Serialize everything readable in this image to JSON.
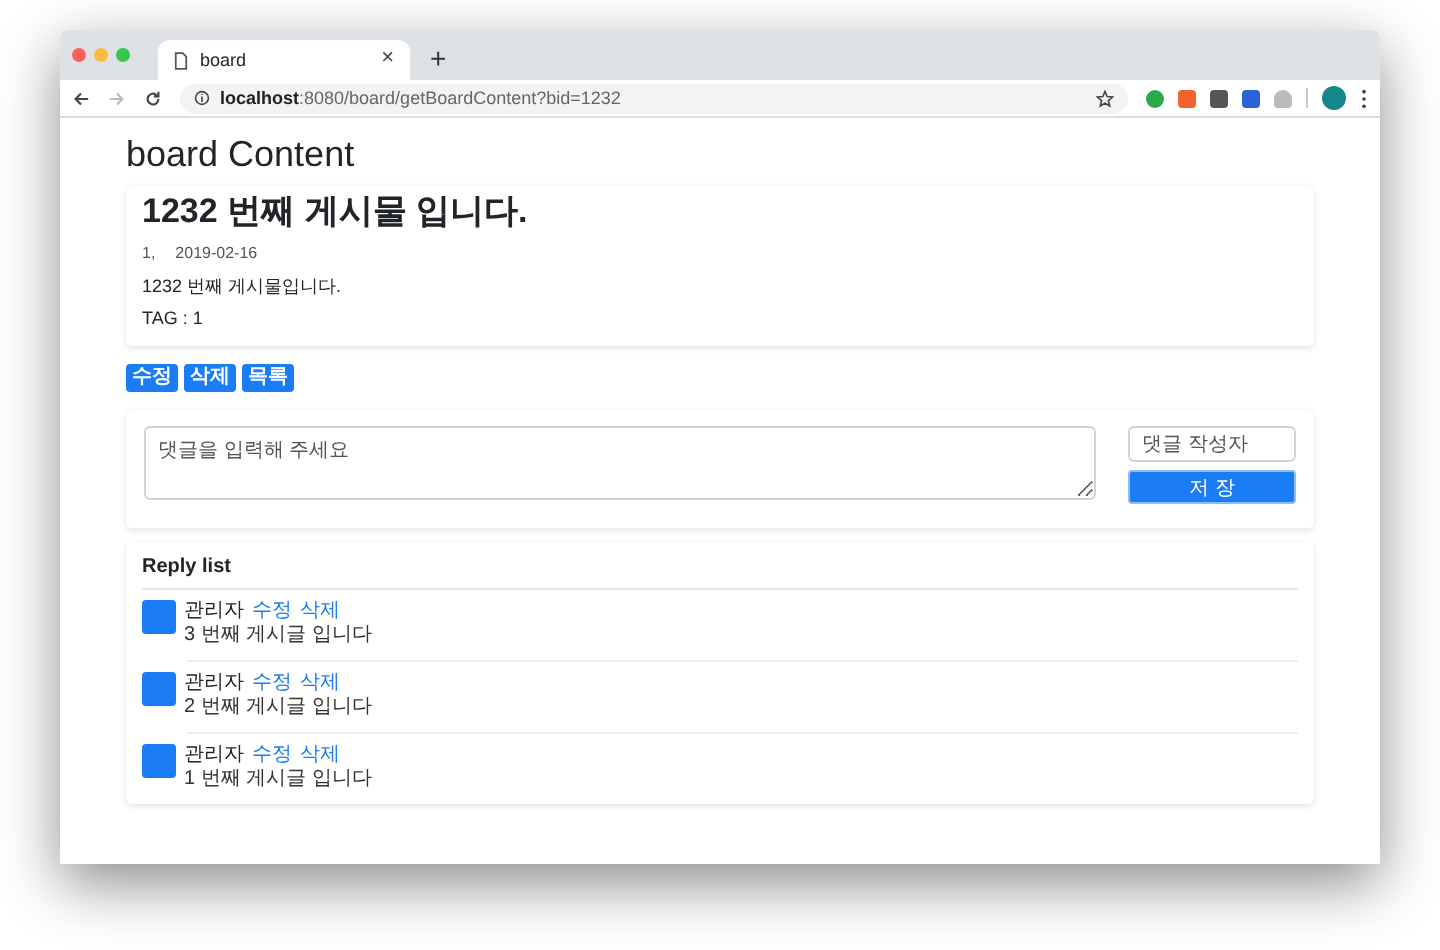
{
  "browser": {
    "tab_title": "board",
    "tab_close": "×",
    "new_tab": "+",
    "url_host": "localhost",
    "url_rest": ":8080/board/getBoardContent?bid=1232"
  },
  "page_title": "board Content",
  "post": {
    "title": "1232 번째 게시물 입니다.",
    "author": "1,",
    "date": "2019-02-16",
    "body": "1232 번째 게시물입니다.",
    "tag": "TAG : 1"
  },
  "actions": [
    "수정",
    "삭제",
    "목록"
  ],
  "reply_form": {
    "content_placeholder": "댓글을 입력해 주세요",
    "writer_placeholder": "댓글 작성자",
    "save": "저 장"
  },
  "reply_list": {
    "title": "Reply list",
    "items": [
      {
        "writer": "관리자",
        "edit": "수정",
        "delete": "삭제",
        "text": "3 번째 게시글 입니다"
      },
      {
        "writer": "관리자",
        "edit": "수정",
        "delete": "삭제",
        "text": "2 번째 게시글 입니다"
      },
      {
        "writer": "관리자",
        "edit": "수정",
        "delete": "삭제",
        "text": "1 번째 게시글 입니다"
      }
    ]
  }
}
